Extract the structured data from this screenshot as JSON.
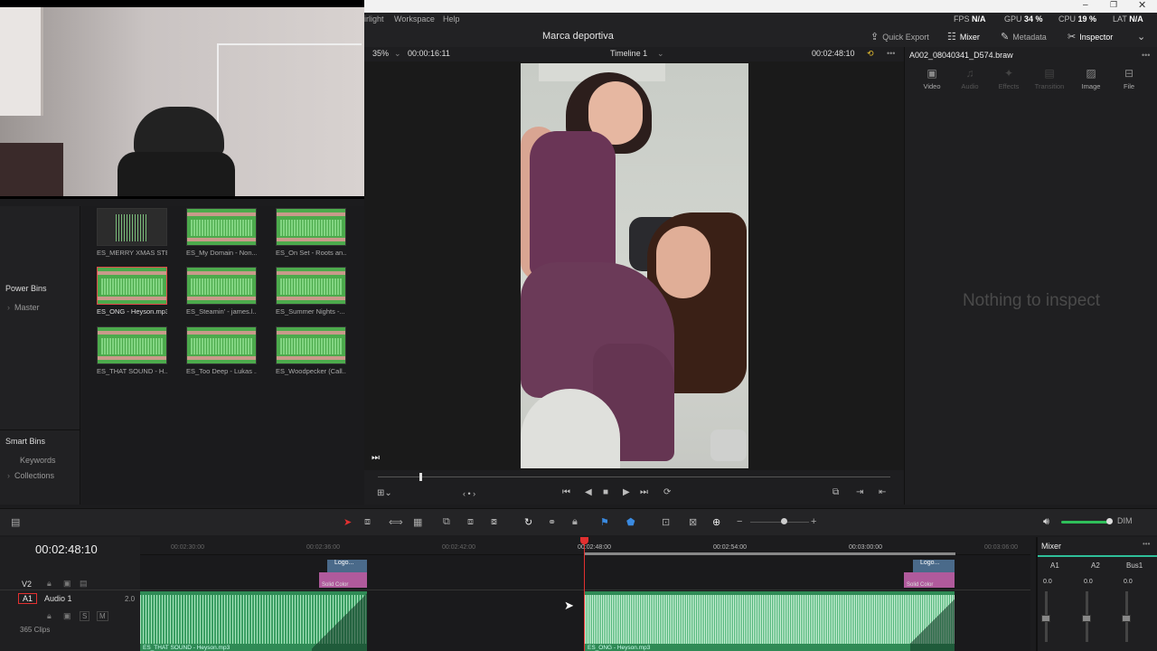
{
  "menu": {
    "item_partial": "irlight",
    "workspace": "Workspace",
    "help": "Help"
  },
  "stats": [
    {
      "label": "FPS",
      "value": "N/A"
    },
    {
      "label": "GPU",
      "value": "34 %"
    },
    {
      "label": "CPU",
      "value": "19 %"
    },
    {
      "label": "LAT",
      "value": "N/A"
    }
  ],
  "header": {
    "project_title": "Marca deportiva",
    "quick_export": "Quick Export",
    "mixer": "Mixer",
    "metadata": "Metadata",
    "inspector": "Inspector"
  },
  "viewer": {
    "zoom": "35%",
    "source_timecode": "00:00:16:11",
    "timeline_name": "Timeline 1",
    "record_timecode": "00:02:48:10"
  },
  "sidebar": {
    "power_bins": "Power Bins",
    "master": "Master",
    "smart_bins": "Smart Bins",
    "keywords": "Keywords",
    "collections": "Collections"
  },
  "media_pool": {
    "clips": [
      {
        "name": "ES_MERRY XMAS STE...",
        "style": "dark"
      },
      {
        "name": "ES_My Domain - Non...",
        "style": "green"
      },
      {
        "name": "ES_On Set - Roots an...",
        "style": "green"
      },
      {
        "name": "ES_ONG - Heyson.mp3",
        "style": "selected"
      },
      {
        "name": "ES_Steamin' - james.l...",
        "style": "green"
      },
      {
        "name": "ES_Summer Nights -...",
        "style": "green"
      },
      {
        "name": "ES_THAT SOUND - H...",
        "style": "green"
      },
      {
        "name": "ES_Too Deep - Lukas ...",
        "style": "green"
      },
      {
        "name": "ES_Woodpecker (Call...",
        "style": "green"
      }
    ]
  },
  "inspector": {
    "file_name": "A002_08040341_D574.braw",
    "tabs": [
      {
        "label": "Video",
        "icon": "film-icon",
        "active": true
      },
      {
        "label": "Audio",
        "icon": "music-note-icon",
        "active": false
      },
      {
        "label": "Effects",
        "icon": "magic-wand-icon",
        "active": false
      },
      {
        "label": "Transition",
        "icon": "transition-icon",
        "active": false
      },
      {
        "label": "Image",
        "icon": "image-icon",
        "active": true
      },
      {
        "label": "File",
        "icon": "file-icon",
        "active": true
      }
    ],
    "empty_message": "Nothing to inspect"
  },
  "timeline": {
    "timecode": "00:02:48:10",
    "ruler": [
      "00:02:30:00",
      "00:02:36:00",
      "00:02:42:00",
      "00:02:48:00",
      "00:02:54:00",
      "00:03:00:00",
      "00:03:06:00"
    ],
    "tracks": {
      "v2_label": "V2",
      "a1_label": "A1",
      "a1_name": "Audio 1",
      "a1_level": "2.0",
      "a1_clip_count": "365 Clips"
    },
    "clips": {
      "left_audio": "ES_THAT SOUND - Heyson.mp3",
      "right_audio": "ES_ONG - Heyson.mp3",
      "logo_left": "Logo...",
      "logo_right": "Logo...",
      "solid_left": "Solid Color",
      "solid_right": "Solid Color"
    },
    "mute_label": "M",
    "solo_label": "S"
  },
  "mixer": {
    "title": "Mixer",
    "channels": [
      "A1",
      "A2",
      "Bus1"
    ],
    "levels": [
      "0.0",
      "0.0",
      "0.0"
    ],
    "fader_db": [
      -10,
      -10,
      -10
    ]
  },
  "colors": {
    "accent_red": "#e23030",
    "audio_green": "#2f8a55",
    "logo_blue": "#4a6a8a",
    "solid_pink": "#b05a9c"
  }
}
